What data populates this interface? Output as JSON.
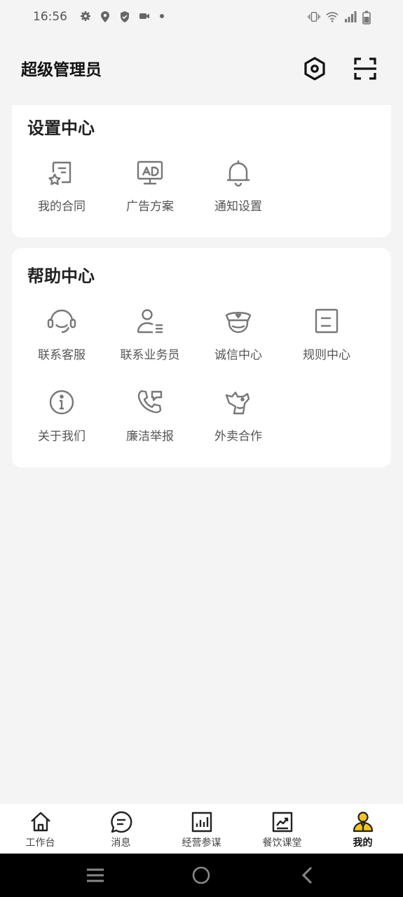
{
  "status_bar": {
    "time": "16:56",
    "left_icons": [
      "gear-icon",
      "location-pin-icon",
      "shield-icon",
      "video-icon",
      "dot-icon"
    ],
    "right_icons": [
      "vibrate-icon",
      "wifi-icon",
      "signal-icon",
      "battery-icon"
    ]
  },
  "header": {
    "title": "超级管理员",
    "settings_icon": "hexagon-settings-icon",
    "scan_icon": "scan-icon"
  },
  "settings_center": {
    "title": "设置中心",
    "items": [
      {
        "label": "我的合同",
        "icon": "contract-icon"
      },
      {
        "label": "广告方案",
        "icon": "ad-monitor-icon"
      },
      {
        "label": "通知设置",
        "icon": "bell-icon"
      }
    ]
  },
  "help_center": {
    "title": "帮助中心",
    "items": [
      {
        "label": "联系客服",
        "icon": "headset-icon"
      },
      {
        "label": "联系业务员",
        "icon": "salesperson-icon"
      },
      {
        "label": "诚信中心",
        "icon": "officer-icon"
      },
      {
        "label": "规则中心",
        "icon": "rules-icon"
      },
      {
        "label": "关于我们",
        "icon": "info-icon"
      },
      {
        "label": "廉洁举报",
        "icon": "phone-report-icon"
      },
      {
        "label": "外卖合作",
        "icon": "kangaroo-icon"
      }
    ]
  },
  "tab_bar": {
    "tabs": [
      {
        "label": "工作台",
        "icon": "home-icon",
        "active": false
      },
      {
        "label": "消息",
        "icon": "message-icon",
        "active": false
      },
      {
        "label": "经营参谋",
        "icon": "bar-chart-icon",
        "active": false
      },
      {
        "label": "餐饮课堂",
        "icon": "course-icon",
        "active": false
      },
      {
        "label": "我的",
        "icon": "profile-icon",
        "active": true
      }
    ],
    "active_color": "#f5c518"
  },
  "nav_bar": {
    "buttons": [
      "menu-icon",
      "home-circle-icon",
      "back-icon"
    ]
  }
}
